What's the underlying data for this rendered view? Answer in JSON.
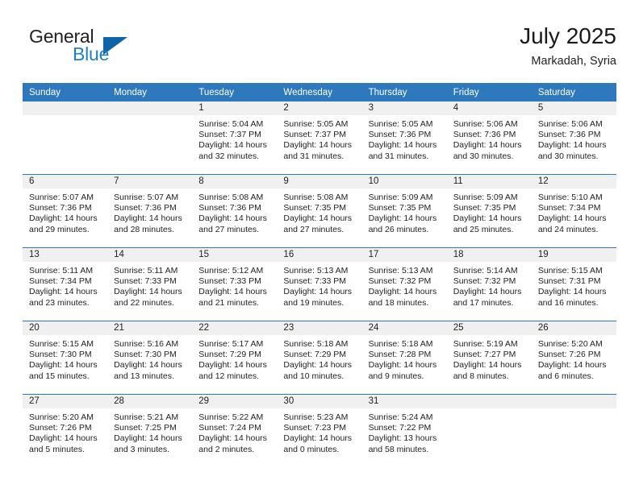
{
  "brand": {
    "name_top": "General",
    "name_bottom": "Blue",
    "triangle_color": "#0d64a8",
    "text_color": "#231f20",
    "accent_color": "#1f7fc4"
  },
  "header": {
    "title": "July 2025",
    "subtitle": "Markadah, Syria"
  },
  "theme": {
    "header_bg": "#2e78bd",
    "header_text": "#ffffff",
    "daynum_bg": "#f0f0f0",
    "body_text": "#222222"
  },
  "weekday_headers": [
    "Sunday",
    "Monday",
    "Tuesday",
    "Wednesday",
    "Thursday",
    "Friday",
    "Saturday"
  ],
  "labels": {
    "sunrise_prefix": "Sunrise:",
    "sunset_prefix": "Sunset:",
    "daylight_prefix": "Daylight:"
  },
  "weeks": [
    [
      {
        "day": "",
        "empty": true
      },
      {
        "day": "",
        "empty": true
      },
      {
        "day": "1",
        "sunrise": "Sunrise: 5:04 AM",
        "sunset": "Sunset: 7:37 PM",
        "daylight": "Daylight: 14 hours and 32 minutes."
      },
      {
        "day": "2",
        "sunrise": "Sunrise: 5:05 AM",
        "sunset": "Sunset: 7:37 PM",
        "daylight": "Daylight: 14 hours and 31 minutes."
      },
      {
        "day": "3",
        "sunrise": "Sunrise: 5:05 AM",
        "sunset": "Sunset: 7:36 PM",
        "daylight": "Daylight: 14 hours and 31 minutes."
      },
      {
        "day": "4",
        "sunrise": "Sunrise: 5:06 AM",
        "sunset": "Sunset: 7:36 PM",
        "daylight": "Daylight: 14 hours and 30 minutes."
      },
      {
        "day": "5",
        "sunrise": "Sunrise: 5:06 AM",
        "sunset": "Sunset: 7:36 PM",
        "daylight": "Daylight: 14 hours and 30 minutes."
      }
    ],
    [
      {
        "day": "6",
        "sunrise": "Sunrise: 5:07 AM",
        "sunset": "Sunset: 7:36 PM",
        "daylight": "Daylight: 14 hours and 29 minutes."
      },
      {
        "day": "7",
        "sunrise": "Sunrise: 5:07 AM",
        "sunset": "Sunset: 7:36 PM",
        "daylight": "Daylight: 14 hours and 28 minutes."
      },
      {
        "day": "8",
        "sunrise": "Sunrise: 5:08 AM",
        "sunset": "Sunset: 7:36 PM",
        "daylight": "Daylight: 14 hours and 27 minutes."
      },
      {
        "day": "9",
        "sunrise": "Sunrise: 5:08 AM",
        "sunset": "Sunset: 7:35 PM",
        "daylight": "Daylight: 14 hours and 27 minutes."
      },
      {
        "day": "10",
        "sunrise": "Sunrise: 5:09 AM",
        "sunset": "Sunset: 7:35 PM",
        "daylight": "Daylight: 14 hours and 26 minutes."
      },
      {
        "day": "11",
        "sunrise": "Sunrise: 5:09 AM",
        "sunset": "Sunset: 7:35 PM",
        "daylight": "Daylight: 14 hours and 25 minutes."
      },
      {
        "day": "12",
        "sunrise": "Sunrise: 5:10 AM",
        "sunset": "Sunset: 7:34 PM",
        "daylight": "Daylight: 14 hours and 24 minutes."
      }
    ],
    [
      {
        "day": "13",
        "sunrise": "Sunrise: 5:11 AM",
        "sunset": "Sunset: 7:34 PM",
        "daylight": "Daylight: 14 hours and 23 minutes."
      },
      {
        "day": "14",
        "sunrise": "Sunrise: 5:11 AM",
        "sunset": "Sunset: 7:33 PM",
        "daylight": "Daylight: 14 hours and 22 minutes."
      },
      {
        "day": "15",
        "sunrise": "Sunrise: 5:12 AM",
        "sunset": "Sunset: 7:33 PM",
        "daylight": "Daylight: 14 hours and 21 minutes."
      },
      {
        "day": "16",
        "sunrise": "Sunrise: 5:13 AM",
        "sunset": "Sunset: 7:33 PM",
        "daylight": "Daylight: 14 hours and 19 minutes."
      },
      {
        "day": "17",
        "sunrise": "Sunrise: 5:13 AM",
        "sunset": "Sunset: 7:32 PM",
        "daylight": "Daylight: 14 hours and 18 minutes."
      },
      {
        "day": "18",
        "sunrise": "Sunrise: 5:14 AM",
        "sunset": "Sunset: 7:32 PM",
        "daylight": "Daylight: 14 hours and 17 minutes."
      },
      {
        "day": "19",
        "sunrise": "Sunrise: 5:15 AM",
        "sunset": "Sunset: 7:31 PM",
        "daylight": "Daylight: 14 hours and 16 minutes."
      }
    ],
    [
      {
        "day": "20",
        "sunrise": "Sunrise: 5:15 AM",
        "sunset": "Sunset: 7:30 PM",
        "daylight": "Daylight: 14 hours and 15 minutes."
      },
      {
        "day": "21",
        "sunrise": "Sunrise: 5:16 AM",
        "sunset": "Sunset: 7:30 PM",
        "daylight": "Daylight: 14 hours and 13 minutes."
      },
      {
        "day": "22",
        "sunrise": "Sunrise: 5:17 AM",
        "sunset": "Sunset: 7:29 PM",
        "daylight": "Daylight: 14 hours and 12 minutes."
      },
      {
        "day": "23",
        "sunrise": "Sunrise: 5:18 AM",
        "sunset": "Sunset: 7:29 PM",
        "daylight": "Daylight: 14 hours and 10 minutes."
      },
      {
        "day": "24",
        "sunrise": "Sunrise: 5:18 AM",
        "sunset": "Sunset: 7:28 PM",
        "daylight": "Daylight: 14 hours and 9 minutes."
      },
      {
        "day": "25",
        "sunrise": "Sunrise: 5:19 AM",
        "sunset": "Sunset: 7:27 PM",
        "daylight": "Daylight: 14 hours and 8 minutes."
      },
      {
        "day": "26",
        "sunrise": "Sunrise: 5:20 AM",
        "sunset": "Sunset: 7:26 PM",
        "daylight": "Daylight: 14 hours and 6 minutes."
      }
    ],
    [
      {
        "day": "27",
        "sunrise": "Sunrise: 5:20 AM",
        "sunset": "Sunset: 7:26 PM",
        "daylight": "Daylight: 14 hours and 5 minutes."
      },
      {
        "day": "28",
        "sunrise": "Sunrise: 5:21 AM",
        "sunset": "Sunset: 7:25 PM",
        "daylight": "Daylight: 14 hours and 3 minutes."
      },
      {
        "day": "29",
        "sunrise": "Sunrise: 5:22 AM",
        "sunset": "Sunset: 7:24 PM",
        "daylight": "Daylight: 14 hours and 2 minutes."
      },
      {
        "day": "30",
        "sunrise": "Sunrise: 5:23 AM",
        "sunset": "Sunset: 7:23 PM",
        "daylight": "Daylight: 14 hours and 0 minutes."
      },
      {
        "day": "31",
        "sunrise": "Sunrise: 5:24 AM",
        "sunset": "Sunset: 7:22 PM",
        "daylight": "Daylight: 13 hours and 58 minutes."
      },
      {
        "day": "",
        "empty": true
      },
      {
        "day": "",
        "empty": true
      }
    ]
  ]
}
